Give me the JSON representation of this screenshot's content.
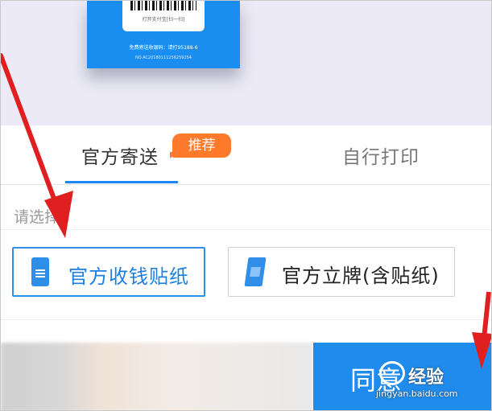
{
  "preview": {
    "qr_caption": "打开支付宝[扫一扫]",
    "card_phone": "免费寄送收银码：请打95188-6",
    "card_no": "NO.AC20180111256259254"
  },
  "tabs": [
    {
      "label": "官方寄送",
      "selected": true
    },
    {
      "label": "自行打印",
      "selected": false
    }
  ],
  "badge": "推荐",
  "select_prompt": "请选择",
  "options": [
    {
      "label": "官方收钱贴纸",
      "selected": true,
      "icon": "sticker-icon"
    },
    {
      "label": "官方立牌(含贴纸)",
      "selected": false,
      "icon": "stand-icon"
    }
  ],
  "agree_button": "同意",
  "watermark": {
    "text": "经验",
    "url": "jingyan.baidu.com"
  },
  "colors": {
    "accent": "#1d86f0",
    "badge": "#ff7a2a",
    "arrow": "#e02020"
  }
}
